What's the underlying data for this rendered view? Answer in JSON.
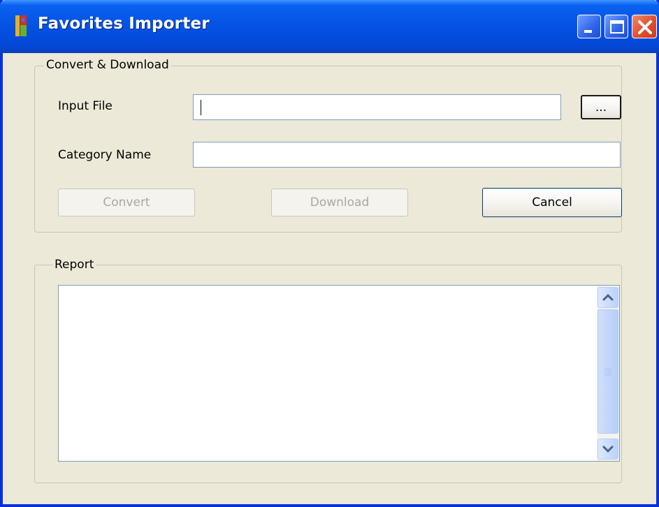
{
  "window": {
    "title": "Favorites Importer",
    "controls": {
      "minimize": "minimize-icon",
      "maximize": "maximize-icon",
      "close": "close-icon"
    }
  },
  "convert_group": {
    "legend": "Convert & Download",
    "input_file_label": "Input File",
    "input_file_value": "",
    "browse_label": "...",
    "category_label": "Category Name",
    "category_value": "",
    "convert_label": "Convert",
    "download_label": "Download",
    "cancel_label": "Cancel"
  },
  "report_group": {
    "legend": "Report",
    "content": ""
  },
  "colors": {
    "titlebar": "#0555e6",
    "window_bg": "#ece9d8",
    "close_button": "#e0502e",
    "input_border": "#7f9db9"
  }
}
